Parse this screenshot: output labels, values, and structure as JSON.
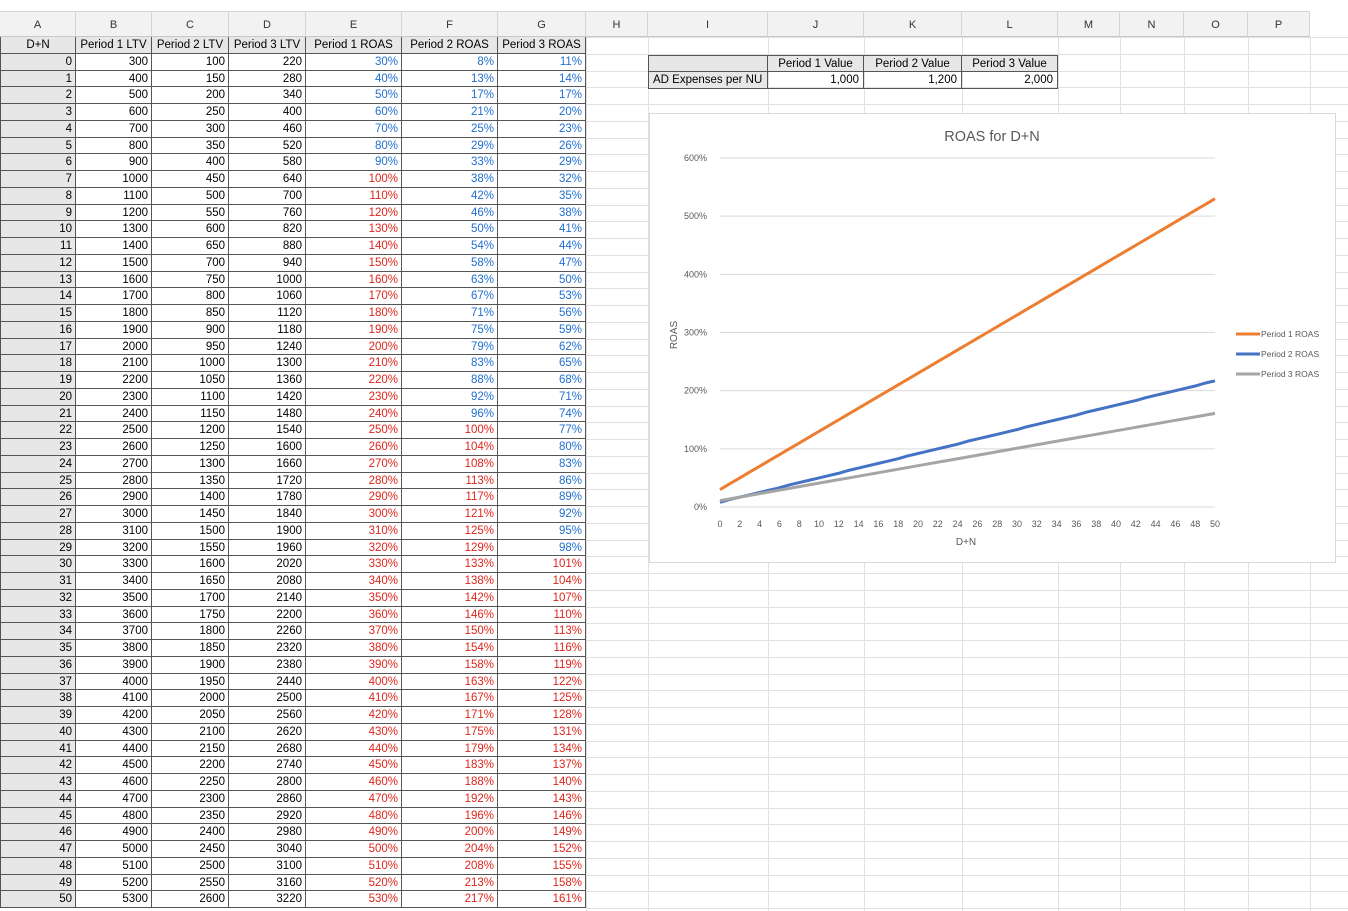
{
  "sheet": {
    "column_letters": [
      "A",
      "B",
      "C",
      "D",
      "E",
      "F",
      "G",
      "H",
      "I",
      "J",
      "K",
      "L",
      "M",
      "N",
      "O",
      "P"
    ],
    "headers": [
      "D+N",
      "Period 1 LTV",
      "Period 2 LTV",
      "Period 3 LTV",
      "Period 1 ROAS",
      "Period 2 ROAS",
      "Period 3 ROAS"
    ],
    "rows": [
      [
        "0",
        "300",
        "100",
        "220",
        "30%",
        "8%",
        "11%"
      ],
      [
        "1",
        "400",
        "150",
        "280",
        "40%",
        "13%",
        "14%"
      ],
      [
        "2",
        "500",
        "200",
        "340",
        "50%",
        "17%",
        "17%"
      ],
      [
        "3",
        "600",
        "250",
        "400",
        "60%",
        "21%",
        "20%"
      ],
      [
        "4",
        "700",
        "300",
        "460",
        "70%",
        "25%",
        "23%"
      ],
      [
        "5",
        "800",
        "350",
        "520",
        "80%",
        "29%",
        "26%"
      ],
      [
        "6",
        "900",
        "400",
        "580",
        "90%",
        "33%",
        "29%"
      ],
      [
        "7",
        "1000",
        "450",
        "640",
        "100%",
        "38%",
        "32%"
      ],
      [
        "8",
        "1100",
        "500",
        "700",
        "110%",
        "42%",
        "35%"
      ],
      [
        "9",
        "1200",
        "550",
        "760",
        "120%",
        "46%",
        "38%"
      ],
      [
        "10",
        "1300",
        "600",
        "820",
        "130%",
        "50%",
        "41%"
      ],
      [
        "11",
        "1400",
        "650",
        "880",
        "140%",
        "54%",
        "44%"
      ],
      [
        "12",
        "1500",
        "700",
        "940",
        "150%",
        "58%",
        "47%"
      ],
      [
        "13",
        "1600",
        "750",
        "1000",
        "160%",
        "63%",
        "50%"
      ],
      [
        "14",
        "1700",
        "800",
        "1060",
        "170%",
        "67%",
        "53%"
      ],
      [
        "15",
        "1800",
        "850",
        "1120",
        "180%",
        "71%",
        "56%"
      ],
      [
        "16",
        "1900",
        "900",
        "1180",
        "190%",
        "75%",
        "59%"
      ],
      [
        "17",
        "2000",
        "950",
        "1240",
        "200%",
        "79%",
        "62%"
      ],
      [
        "18",
        "2100",
        "1000",
        "1300",
        "210%",
        "83%",
        "65%"
      ],
      [
        "19",
        "2200",
        "1050",
        "1360",
        "220%",
        "88%",
        "68%"
      ],
      [
        "20",
        "2300",
        "1100",
        "1420",
        "230%",
        "92%",
        "71%"
      ],
      [
        "21",
        "2400",
        "1150",
        "1480",
        "240%",
        "96%",
        "74%"
      ],
      [
        "22",
        "2500",
        "1200",
        "1540",
        "250%",
        "100%",
        "77%"
      ],
      [
        "23",
        "2600",
        "1250",
        "1600",
        "260%",
        "104%",
        "80%"
      ],
      [
        "24",
        "2700",
        "1300",
        "1660",
        "270%",
        "108%",
        "83%"
      ],
      [
        "25",
        "2800",
        "1350",
        "1720",
        "280%",
        "113%",
        "86%"
      ],
      [
        "26",
        "2900",
        "1400",
        "1780",
        "290%",
        "117%",
        "89%"
      ],
      [
        "27",
        "3000",
        "1450",
        "1840",
        "300%",
        "121%",
        "92%"
      ],
      [
        "28",
        "3100",
        "1500",
        "1900",
        "310%",
        "125%",
        "95%"
      ],
      [
        "29",
        "3200",
        "1550",
        "1960",
        "320%",
        "129%",
        "98%"
      ],
      [
        "30",
        "3300",
        "1600",
        "2020",
        "330%",
        "133%",
        "101%"
      ],
      [
        "31",
        "3400",
        "1650",
        "2080",
        "340%",
        "138%",
        "104%"
      ],
      [
        "32",
        "3500",
        "1700",
        "2140",
        "350%",
        "142%",
        "107%"
      ],
      [
        "33",
        "3600",
        "1750",
        "2200",
        "360%",
        "146%",
        "110%"
      ],
      [
        "34",
        "3700",
        "1800",
        "2260",
        "370%",
        "150%",
        "113%"
      ],
      [
        "35",
        "3800",
        "1850",
        "2320",
        "380%",
        "154%",
        "116%"
      ],
      [
        "36",
        "3900",
        "1900",
        "2380",
        "390%",
        "158%",
        "119%"
      ],
      [
        "37",
        "4000",
        "1950",
        "2440",
        "400%",
        "163%",
        "122%"
      ],
      [
        "38",
        "4100",
        "2000",
        "2500",
        "410%",
        "167%",
        "125%"
      ],
      [
        "39",
        "4200",
        "2050",
        "2560",
        "420%",
        "171%",
        "128%"
      ],
      [
        "40",
        "4300",
        "2100",
        "2620",
        "430%",
        "175%",
        "131%"
      ],
      [
        "41",
        "4400",
        "2150",
        "2680",
        "440%",
        "179%",
        "134%"
      ],
      [
        "42",
        "4500",
        "2200",
        "2740",
        "450%",
        "183%",
        "137%"
      ],
      [
        "43",
        "4600",
        "2250",
        "2800",
        "460%",
        "188%",
        "140%"
      ],
      [
        "44",
        "4700",
        "2300",
        "2860",
        "470%",
        "192%",
        "143%"
      ],
      [
        "45",
        "4800",
        "2350",
        "2920",
        "480%",
        "196%",
        "146%"
      ],
      [
        "46",
        "4900",
        "2400",
        "2980",
        "490%",
        "200%",
        "149%"
      ],
      [
        "47",
        "5000",
        "2450",
        "3040",
        "500%",
        "204%",
        "152%"
      ],
      [
        "48",
        "5100",
        "2500",
        "3100",
        "510%",
        "208%",
        "155%"
      ],
      [
        "49",
        "5200",
        "2550",
        "3160",
        "520%",
        "213%",
        "158%"
      ],
      [
        "50",
        "5300",
        "2600",
        "3220",
        "530%",
        "217%",
        "161%"
      ]
    ],
    "colors": {
      "blue": "#1f6fd1",
      "red": "#e0251b",
      "header_fill": "#e7e7e7"
    }
  },
  "expenses": {
    "headers": [
      "Period 1 Value",
      "Period 2 Value",
      "Period 3 Value"
    ],
    "row_label": "AD Expenses per NU",
    "values": [
      "1,000",
      "1,200",
      "2,000"
    ]
  },
  "chart_data": {
    "type": "line",
    "title": "ROAS for D+N",
    "xlabel": "D+N",
    "ylabel": "ROAS",
    "ylim": [
      0,
      600
    ],
    "y_ticks": [
      "0%",
      "100%",
      "200%",
      "300%",
      "400%",
      "500%",
      "600%"
    ],
    "x_ticks": [
      "0",
      "2",
      "4",
      "6",
      "8",
      "10",
      "12",
      "14",
      "16",
      "18",
      "20",
      "22",
      "24",
      "26",
      "28",
      "30",
      "32",
      "34",
      "36",
      "38",
      "40",
      "42",
      "44",
      "46",
      "48",
      "50"
    ],
    "x": [
      0,
      1,
      2,
      3,
      4,
      5,
      6,
      7,
      8,
      9,
      10,
      11,
      12,
      13,
      14,
      15,
      16,
      17,
      18,
      19,
      20,
      21,
      22,
      23,
      24,
      25,
      26,
      27,
      28,
      29,
      30,
      31,
      32,
      33,
      34,
      35,
      36,
      37,
      38,
      39,
      40,
      41,
      42,
      43,
      44,
      45,
      46,
      47,
      48,
      49,
      50
    ],
    "series": [
      {
        "name": "Period 1 ROAS",
        "color": "#ed7d31",
        "values": [
          30,
          40,
          50,
          60,
          70,
          80,
          90,
          100,
          110,
          120,
          130,
          140,
          150,
          160,
          170,
          180,
          190,
          200,
          210,
          220,
          230,
          240,
          250,
          260,
          270,
          280,
          290,
          300,
          310,
          320,
          330,
          340,
          350,
          360,
          370,
          380,
          390,
          400,
          410,
          420,
          430,
          440,
          450,
          460,
          470,
          480,
          490,
          500,
          510,
          520,
          530
        ]
      },
      {
        "name": "Period 2 ROAS",
        "color": "#4472c4",
        "values": [
          8,
          13,
          17,
          21,
          25,
          29,
          33,
          38,
          42,
          46,
          50,
          54,
          58,
          63,
          67,
          71,
          75,
          79,
          83,
          88,
          92,
          96,
          100,
          104,
          108,
          113,
          117,
          121,
          125,
          129,
          133,
          138,
          142,
          146,
          150,
          154,
          158,
          163,
          167,
          171,
          175,
          179,
          183,
          188,
          192,
          196,
          200,
          204,
          208,
          213,
          217
        ]
      },
      {
        "name": "Period 3 ROAS",
        "color": "#a5a5a5",
        "values": [
          11,
          14,
          17,
          20,
          23,
          26,
          29,
          32,
          35,
          38,
          41,
          44,
          47,
          50,
          53,
          56,
          59,
          62,
          65,
          68,
          71,
          74,
          77,
          80,
          83,
          86,
          89,
          92,
          95,
          98,
          101,
          104,
          107,
          110,
          113,
          116,
          119,
          122,
          125,
          128,
          131,
          134,
          137,
          140,
          143,
          146,
          149,
          152,
          155,
          158,
          161
        ]
      }
    ],
    "legend_position": "right",
    "grid": true
  }
}
